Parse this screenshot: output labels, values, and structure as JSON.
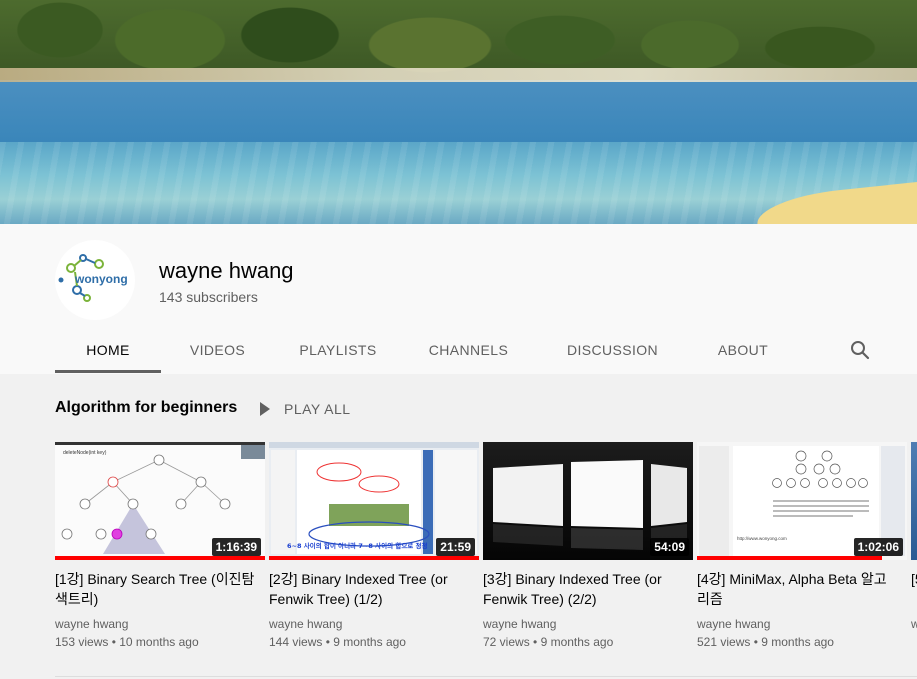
{
  "channel": {
    "name": "wayne hwang",
    "subscribers": "143 subscribers",
    "avatar_text": "wonyong"
  },
  "tabs": [
    "HOME",
    "VIDEOS",
    "PLAYLISTS",
    "CHANNELS",
    "DISCUSSION",
    "ABOUT"
  ],
  "active_tab": "HOME",
  "shelf": {
    "title": "Algorithm for beginners",
    "play_all": "PLAY ALL"
  },
  "videos": [
    {
      "title": "[1강] Binary Search Tree (이진탐색트리)",
      "channel": "wayne hwang",
      "views": "153 views",
      "age": "10 months ago",
      "duration": "1:16:39",
      "watched": 1.0
    },
    {
      "title": "[2강] Binary Indexed Tree (or Fenwik Tree) (1/2)",
      "channel": "wayne hwang",
      "views": "144 views",
      "age": "9 months ago",
      "duration": "21:59",
      "watched": 1.0
    },
    {
      "title": "[3강] Binary Indexed Tree (or Fenwik Tree) (2/2)",
      "channel": "wayne hwang",
      "views": "72 views",
      "age": "9 months ago",
      "duration": "54:09",
      "watched": 0
    },
    {
      "title": "[4강] MiniMax, Alpha Beta 알고리즘",
      "channel": "wayne hwang",
      "views": "521 views",
      "age": "9 months ago",
      "duration": "1:02:06",
      "watched": 0.88
    },
    {
      "title": "[5",
      "channel": "w",
      "views": "",
      "age": "",
      "duration": "",
      "watched": 0
    }
  ],
  "thumb_text": {
    "v1_label": "deleteNode(int key)",
    "v2_caption": "6~8 사이의 합이 아니라 7~8 사이의 합으로 정정",
    "v4_url": "http://www.wonyong.com"
  },
  "colors": {
    "progress": "#ff0000",
    "header_bg": "#f9f9f9",
    "page_bg": "#f1f1f1",
    "tab_indicator": "#606060"
  },
  "icons": {
    "search": "search-icon",
    "play": "play-icon"
  }
}
